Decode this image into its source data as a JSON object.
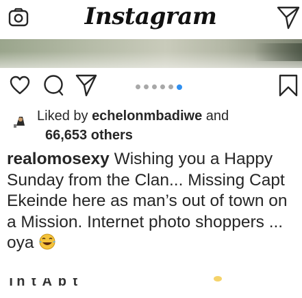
{
  "header": {
    "app_name": "Instagram",
    "left_icon": "camera-icon",
    "right_icon": "direct-send-icon"
  },
  "actions": {
    "like_icon": "heart-icon",
    "comment_icon": "comment-icon",
    "share_icon": "send-icon",
    "save_icon": "bookmark-icon",
    "carousel": {
      "total": 6,
      "active_index": 5
    }
  },
  "likes": {
    "prefix": "Liked by ",
    "liker": "echelonmbadiwe",
    "conjunction": " and",
    "others": "66,653 others"
  },
  "caption": {
    "username": "realomosexy",
    "text": " Wishing you a Happy Sunday from the Clan... Missing Capt Ekeinde here as man’s out of town on a Mission. Internet photo shoppers ... oya ",
    "emoji": "laughing-tears-emoji"
  },
  "cut_off_text": "Th  t  A  b  t    ",
  "colors": {
    "text": "#262626",
    "carousel_active": "#2f8ff0",
    "carousel_inactive": "#a8a8a8"
  }
}
